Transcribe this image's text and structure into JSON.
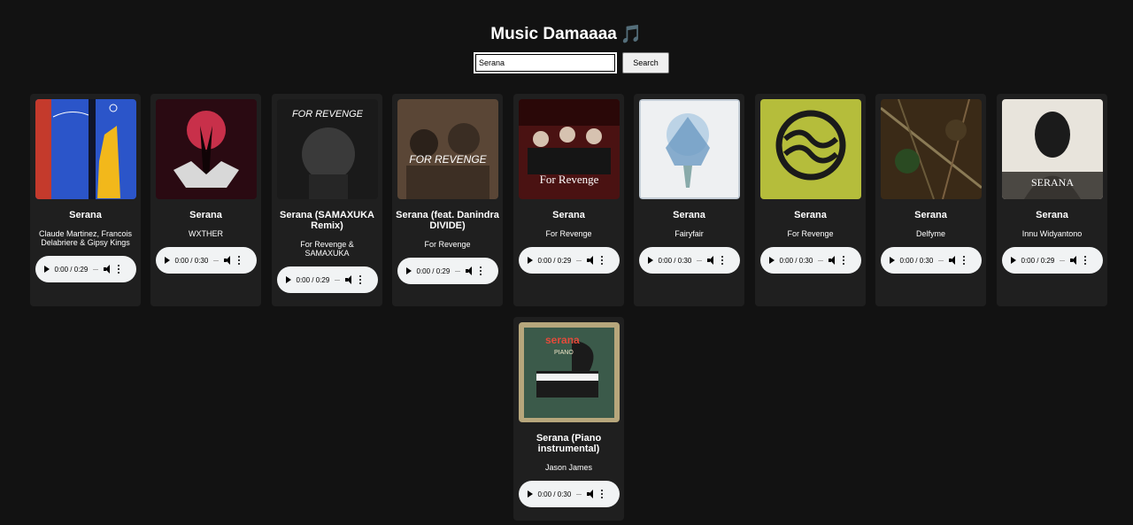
{
  "header": {
    "title": "Music Damaaaa",
    "title_emoji": "🎵"
  },
  "search": {
    "value": "Serana",
    "button_label": "Search"
  },
  "colors": {
    "background": "#121212",
    "card": "#1f1f1f",
    "player": "#f1f3f4"
  },
  "songs": [
    {
      "title": "Serana",
      "artist": "Claude Martinez, Francois Delabriere & Gipsy Kings",
      "time": "0:00 / 0:29",
      "cover_icon": "album-cover-gipsy-kings"
    },
    {
      "title": "Serana",
      "artist": "WXTHER",
      "time": "0:00 / 0:30",
      "cover_icon": "album-cover-wxther"
    },
    {
      "title": "Serana (SAMAXUKA Remix)",
      "artist": "For Revenge & SAMAXUKA",
      "time": "0:00 / 0:29",
      "cover_icon": "album-cover-for-revenge-remix",
      "cover_text": "FOR REVENGE"
    },
    {
      "title": "Serana (feat. Danindra DIVIDE)",
      "artist": "For Revenge",
      "time": "0:00 / 0:29",
      "cover_icon": "album-cover-for-revenge-feat",
      "cover_text": "FOR REVENGE"
    },
    {
      "title": "Serana",
      "artist": "For Revenge",
      "time": "0:00 / 0:29",
      "cover_icon": "album-cover-for-revenge-band",
      "cover_text": "For Revenge"
    },
    {
      "title": "Serana",
      "artist": "Fairyfair",
      "time": "0:00 / 0:30",
      "cover_icon": "album-cover-fairyfair"
    },
    {
      "title": "Serana",
      "artist": "For Revenge",
      "time": "0:00 / 0:30",
      "cover_icon": "album-cover-for-revenge-logo"
    },
    {
      "title": "Serana",
      "artist": "Delfyme",
      "time": "0:00 / 0:30",
      "cover_icon": "album-cover-delfyme"
    },
    {
      "title": "Serana",
      "artist": "Innu Widyantono",
      "time": "0:00 / 0:29",
      "cover_icon": "album-cover-innu-widyantono",
      "cover_text": "SERANA"
    },
    {
      "title": "Serana (Piano instrumental)",
      "artist": "Jason James",
      "time": "0:00 / 0:30",
      "cover_icon": "album-cover-piano",
      "cover_text": "serana",
      "cover_subtext": "PIANO"
    }
  ]
}
